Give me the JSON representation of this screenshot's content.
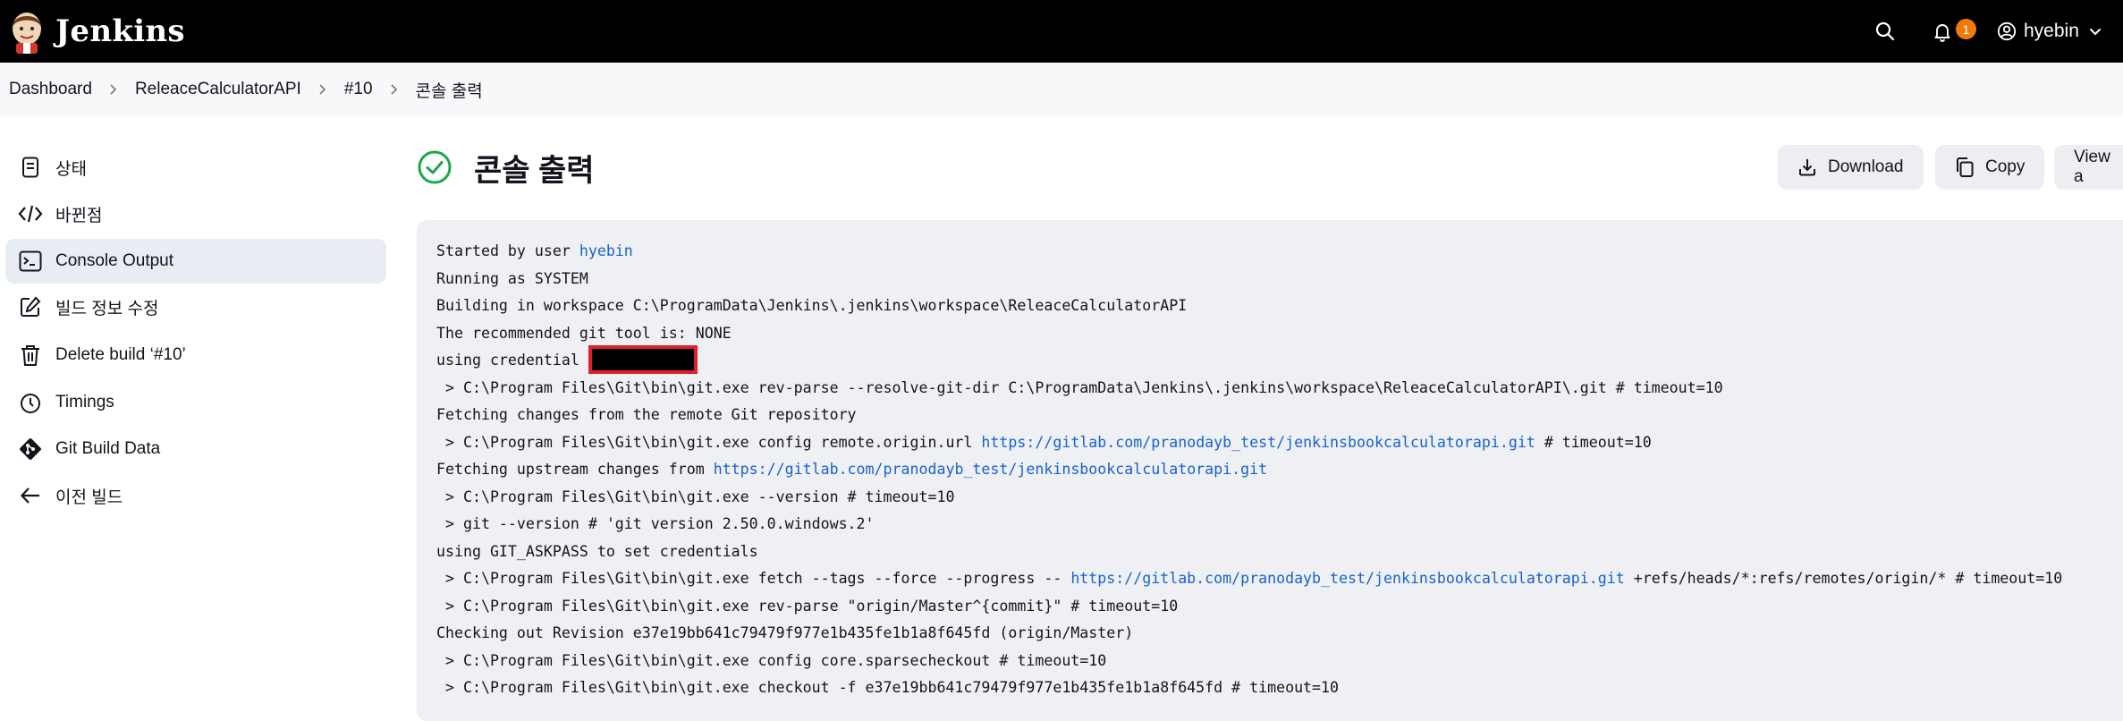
{
  "header": {
    "brand": "Jenkins",
    "notification_count": "1",
    "user_name": "hyebin"
  },
  "breadcrumb": [
    "Dashboard",
    "ReleaceCalculatorAPI",
    "#10",
    "콘솔 출력"
  ],
  "sidebar": {
    "items": [
      {
        "label": "상태",
        "icon": "document-icon"
      },
      {
        "label": "바뀐점",
        "icon": "code-icon"
      },
      {
        "label": "Console Output",
        "icon": "terminal-icon",
        "active": true
      },
      {
        "label": "빌드 정보 수정",
        "icon": "edit-icon"
      },
      {
        "label": "Delete build ‘#10’",
        "icon": "trash-icon"
      },
      {
        "label": "Timings",
        "icon": "stopwatch-icon"
      },
      {
        "label": "Git Build Data",
        "icon": "git-icon"
      },
      {
        "label": "이전 빌드",
        "icon": "arrow-left-icon"
      }
    ]
  },
  "main": {
    "title": "콘솔 출력",
    "status_icon": "success-check-icon",
    "buttons": {
      "download": "Download",
      "copy": "Copy",
      "view": "View a"
    }
  },
  "console": {
    "lines": [
      {
        "parts": [
          {
            "t": "Started by user "
          },
          {
            "t": "hyebin",
            "link": true
          }
        ]
      },
      {
        "parts": [
          {
            "t": "Running as SYSTEM"
          }
        ]
      },
      {
        "parts": [
          {
            "t": "Building in workspace C:\\ProgramData\\Jenkins\\.jenkins\\workspace\\ReleaceCalculatorAPI"
          }
        ]
      },
      {
        "parts": [
          {
            "t": "The recommended git tool is: NONE"
          }
        ]
      },
      {
        "parts": [
          {
            "t": "using credential "
          },
          {
            "masked": true
          }
        ]
      },
      {
        "parts": [
          {
            "t": " > C:\\Program Files\\Git\\bin\\git.exe rev-parse --resolve-git-dir C:\\ProgramData\\Jenkins\\.jenkins\\workspace\\ReleaceCalculatorAPI\\.git # timeout=10"
          }
        ]
      },
      {
        "parts": [
          {
            "t": "Fetching changes from the remote Git repository"
          }
        ]
      },
      {
        "parts": [
          {
            "t": " > C:\\Program Files\\Git\\bin\\git.exe config remote.origin.url "
          },
          {
            "t": "https://gitlab.com/pranodayb_test/jenkinsbookcalculatorapi.git",
            "link": true
          },
          {
            "t": " # timeout=10"
          }
        ]
      },
      {
        "parts": [
          {
            "t": "Fetching upstream changes from "
          },
          {
            "t": "https://gitlab.com/pranodayb_test/jenkinsbookcalculatorapi.git",
            "link": true
          }
        ]
      },
      {
        "parts": [
          {
            "t": " > C:\\Program Files\\Git\\bin\\git.exe --version # timeout=10"
          }
        ]
      },
      {
        "parts": [
          {
            "t": " > git --version # 'git version 2.50.0.windows.2'"
          }
        ]
      },
      {
        "parts": [
          {
            "t": "using GIT_ASKPASS to set credentials"
          }
        ]
      },
      {
        "parts": [
          {
            "t": " > C:\\Program Files\\Git\\bin\\git.exe fetch --tags --force --progress -- "
          },
          {
            "t": "https://gitlab.com/pranodayb_test/jenkinsbookcalculatorapi.git",
            "link": true
          },
          {
            "t": " +refs/heads/*:refs/remotes/origin/* # timeout=10"
          }
        ]
      },
      {
        "parts": [
          {
            "t": " > C:\\Program Files\\Git\\bin\\git.exe rev-parse \"origin/Master^{commit}\" # timeout=10"
          }
        ]
      },
      {
        "parts": [
          {
            "t": "Checking out Revision e37e19bb641c79479f977e1b435fe1b1a8f645fd (origin/Master)"
          }
        ]
      },
      {
        "parts": [
          {
            "t": " > C:\\Program Files\\Git\\bin\\git.exe config core.sparsecheckout # timeout=10"
          }
        ]
      },
      {
        "parts": [
          {
            "t": " > C:\\Program Files\\Git\\bin\\git.exe checkout -f e37e19bb641c79479f977e1b435fe1b1a8f645fd # timeout=10"
          }
        ]
      }
    ]
  },
  "colors": {
    "header_bg": "#000000",
    "badge": "#f07a0c",
    "success": "#1ea64b",
    "link": "#1862d0",
    "mask_border": "#e0212c"
  }
}
